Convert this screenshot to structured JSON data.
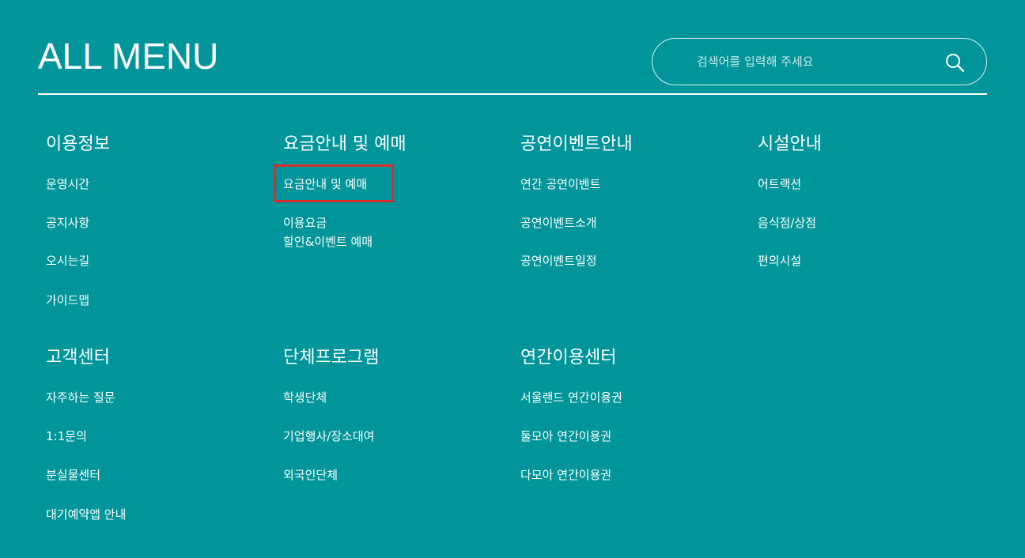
{
  "header": {
    "title": "ALL MENU",
    "search": {
      "placeholder": "검색어를 입력해 주세요",
      "value": ""
    }
  },
  "menu": {
    "info": {
      "title": "이용정보",
      "items": [
        "운영시간",
        "공지사항",
        "오시는길",
        "가이드맵"
      ]
    },
    "ticket": {
      "title": "요금안내 및 예매",
      "items": [
        "요금안내 및 예매",
        "이용요금",
        "할인&이벤트 예매"
      ]
    },
    "event": {
      "title": "공연이벤트안내",
      "items": [
        "연간 공연이벤트",
        "공연이벤트소개",
        "공연이벤트일정"
      ]
    },
    "facility": {
      "title": "시설안내",
      "items": [
        "어트랙션",
        "음식점/상점",
        "편의시설"
      ]
    },
    "customer": {
      "title": "고객센터",
      "items": [
        "자주하는 질문",
        "1:1문의",
        "분실물센터",
        "대기예약앱 안내"
      ]
    },
    "group": {
      "title": "단체프로그램",
      "items": [
        "학생단체",
        "기업행사/장소대여",
        "외국인단체"
      ]
    },
    "annual": {
      "title": "연간이용센터",
      "items": [
        "서울랜드 연간이용권",
        "둘모아 연간이용권",
        "다모아 연간이용권"
      ]
    }
  },
  "colors": {
    "background": "#00959a",
    "text": "#ffffff",
    "highlight_border": "#d62e2e"
  },
  "icons": {
    "search": "search-icon"
  }
}
